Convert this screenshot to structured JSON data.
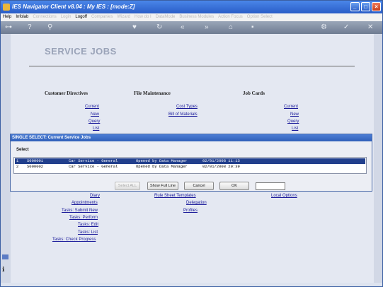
{
  "window": {
    "title": "IES Navigator Client v8.04 : My IES :     [mode:Z]"
  },
  "menu": {
    "items": [
      {
        "label": "Help",
        "enabled": true
      },
      {
        "label": "Infolab",
        "enabled": true
      },
      {
        "label": "Connections",
        "enabled": false
      },
      {
        "label": "Login",
        "enabled": false
      },
      {
        "label": "Logoff",
        "enabled": true
      },
      {
        "label": "Companies",
        "enabled": false
      },
      {
        "label": "Wizard",
        "enabled": false
      },
      {
        "label": "How do I",
        "enabled": false
      },
      {
        "label": "DataMode",
        "enabled": false
      },
      {
        "label": "Business Modules",
        "enabled": false
      },
      {
        "label": "Action Focus",
        "enabled": false
      },
      {
        "label": "Option Select",
        "enabled": false
      }
    ]
  },
  "page": {
    "title": "SERVICE JOBS"
  },
  "columns": {
    "customer_directives": "Customer Directives",
    "file_maintenance": "File Maintenance",
    "job_cards": "Job Cards"
  },
  "links": {
    "cd_current": "Current",
    "cd_new": "New",
    "cd_query": "Query",
    "cd_list": "List",
    "fm_cost_types": "Cost Types",
    "fm_bill_of_materials": "Bill of Materials",
    "jc_current": "Current",
    "jc_new": "New",
    "jc_query": "Query",
    "jc_list": "List",
    "diary": "Diary",
    "appointments": "Appointments",
    "tasks_submit_new": "Tasks: Submit New",
    "tasks_perform": "Tasks: Perform",
    "tasks_edit": "Tasks: Edit",
    "tasks_list": "Tasks: List",
    "tasks_check_progress": "Tasks: Check Progress",
    "rule_sheet_templates": "Rule Sheet Templates",
    "delegation": "Delegation",
    "profiles": "Profiles",
    "local_options": "Local Options"
  },
  "dialog": {
    "title": "SINGLE SELECT: Current Service Jobs",
    "select_label": "Select",
    "rows": [
      {
        "num": "1",
        "code": "S000001",
        "desc": "Car Service - General",
        "status": "Opened by Data Manager",
        "date": "02/01/2008 11:13",
        "selected": true
      },
      {
        "num": "2",
        "code": "S000002",
        "desc": "Car Service - General",
        "status": "Opened by Data Manager",
        "date": "02/01/2008 20:39",
        "selected": false
      }
    ],
    "buttons": {
      "select_all": "Select ALL",
      "show_full_line": "Show Full Line",
      "cancel": "Cancel",
      "ok": "OK"
    },
    "input_value": ""
  }
}
